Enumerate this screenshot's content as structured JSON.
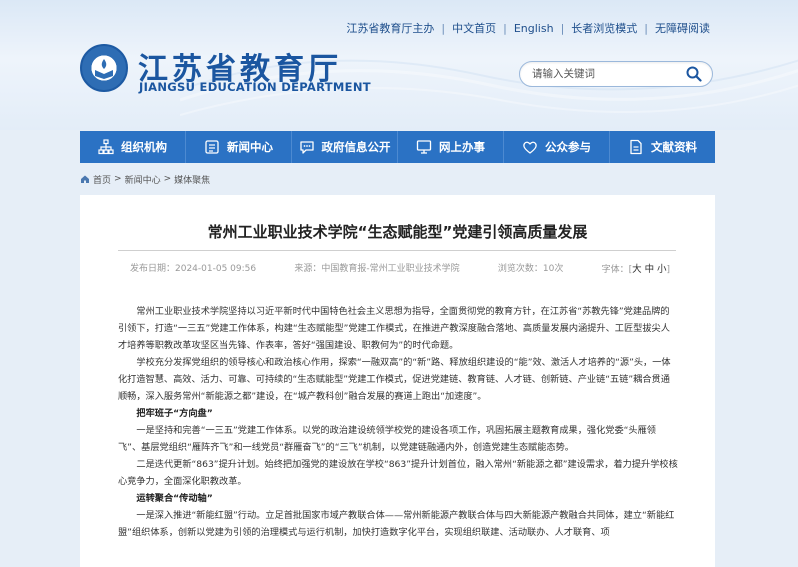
{
  "topbar": {
    "host": "江苏省教育厅主办",
    "links": [
      "中文首页",
      "English",
      "长者浏览模式",
      "无障碍阅读"
    ]
  },
  "brand": {
    "title_cn": "江苏省教育厅",
    "title_en": "JIANGSU EDUCATION DEPARTMENT",
    "color": "#1b56a0"
  },
  "search": {
    "placeholder": "请输入关键词"
  },
  "nav": {
    "color": "#2b72c4",
    "items": [
      {
        "label": "组织机构",
        "icon": "org-chart-icon"
      },
      {
        "label": "新闻中心",
        "icon": "news-icon"
      },
      {
        "label": "政府信息公开",
        "icon": "chat-icon"
      },
      {
        "label": "网上办事",
        "icon": "monitor-icon"
      },
      {
        "label": "公众参与",
        "icon": "heart-icon"
      },
      {
        "label": "文献资料",
        "icon": "document-icon"
      }
    ]
  },
  "breadcrumb": [
    "首页",
    "新闻中心",
    "媒体聚焦"
  ],
  "article": {
    "title": "常州工业职业技术学院“生态赋能型”党建引领高质量发展",
    "meta": {
      "date": "发布日期：2024-01-05 09:56",
      "source": "来源：中国教育报-常州工业职业技术学院",
      "views": "浏览次数：10次",
      "font_label": "字体：[",
      "sizes": [
        "大",
        "中",
        "小"
      ],
      "close": "]"
    },
    "paragraphs": [
      {
        "type": "text",
        "text": "常州工业职业技术学院坚持以习近平新时代中国特色社会主义思想为指导，全面贯彻党的教育方针，在江苏省“苏教先锋”党建品牌的引领下，打造“一三五”党建工作体系，构建“生态赋能型”党建工作模式，在推进产教深度融合落地、高质量发展内涵提升、工匠型拔尖人才培养等职教改革攻坚区当先锋、作表率，答好“强国建设、职教何为”的时代命题。"
      },
      {
        "type": "text",
        "text": "学校充分发挥党组织的领导核心和政治核心作用，探索“一融双高”的“新”路、释放组织建设的“能”效、激活人才培养的“源”头，一体化打造智慧、高效、活力、可靠、可持续的“生态赋能型”党建工作模式，促进党建链、教育链、人才链、创新链、产业链“五链”耦合贯通顺畅，深入服务常州“新能源之都”建设，在“城产教科创”融合发展的赛道上跑出“加速度”。"
      },
      {
        "type": "head",
        "text": "把牢班子“方向盘”"
      },
      {
        "type": "text",
        "text": "一是坚持和完善“一三五”党建工作体系。以党的政治建设统领学校党的建设各项工作，巩固拓展主题教育成果，强化党委“头雁领飞”、基层党组织“雁阵齐飞”和一线党员“群雁奋飞”的“三飞”机制，以党建链融通内外，创造党建生态赋能态势。"
      },
      {
        "type": "text",
        "text": "二是迭代更新“863”提升计划。始终把加强党的建设放在学校“863”提升计划首位，融入常州“新能源之都”建设需求，着力提升学校核心竞争力，全面深化职教改革。"
      },
      {
        "type": "head",
        "text": "运转聚合“传动轴”"
      },
      {
        "type": "text",
        "text": "一是深入推进“新能红盟”行动。立足首批国家市域产教联合体——常州新能源产教联合体与四大新能源产教融合共同体，建立“新能红盟”组织体系，创新以党建为引领的治理模式与运行机制，加快打造数字化平台，实现组织联建、活动联办、人才联育、项"
      }
    ]
  }
}
